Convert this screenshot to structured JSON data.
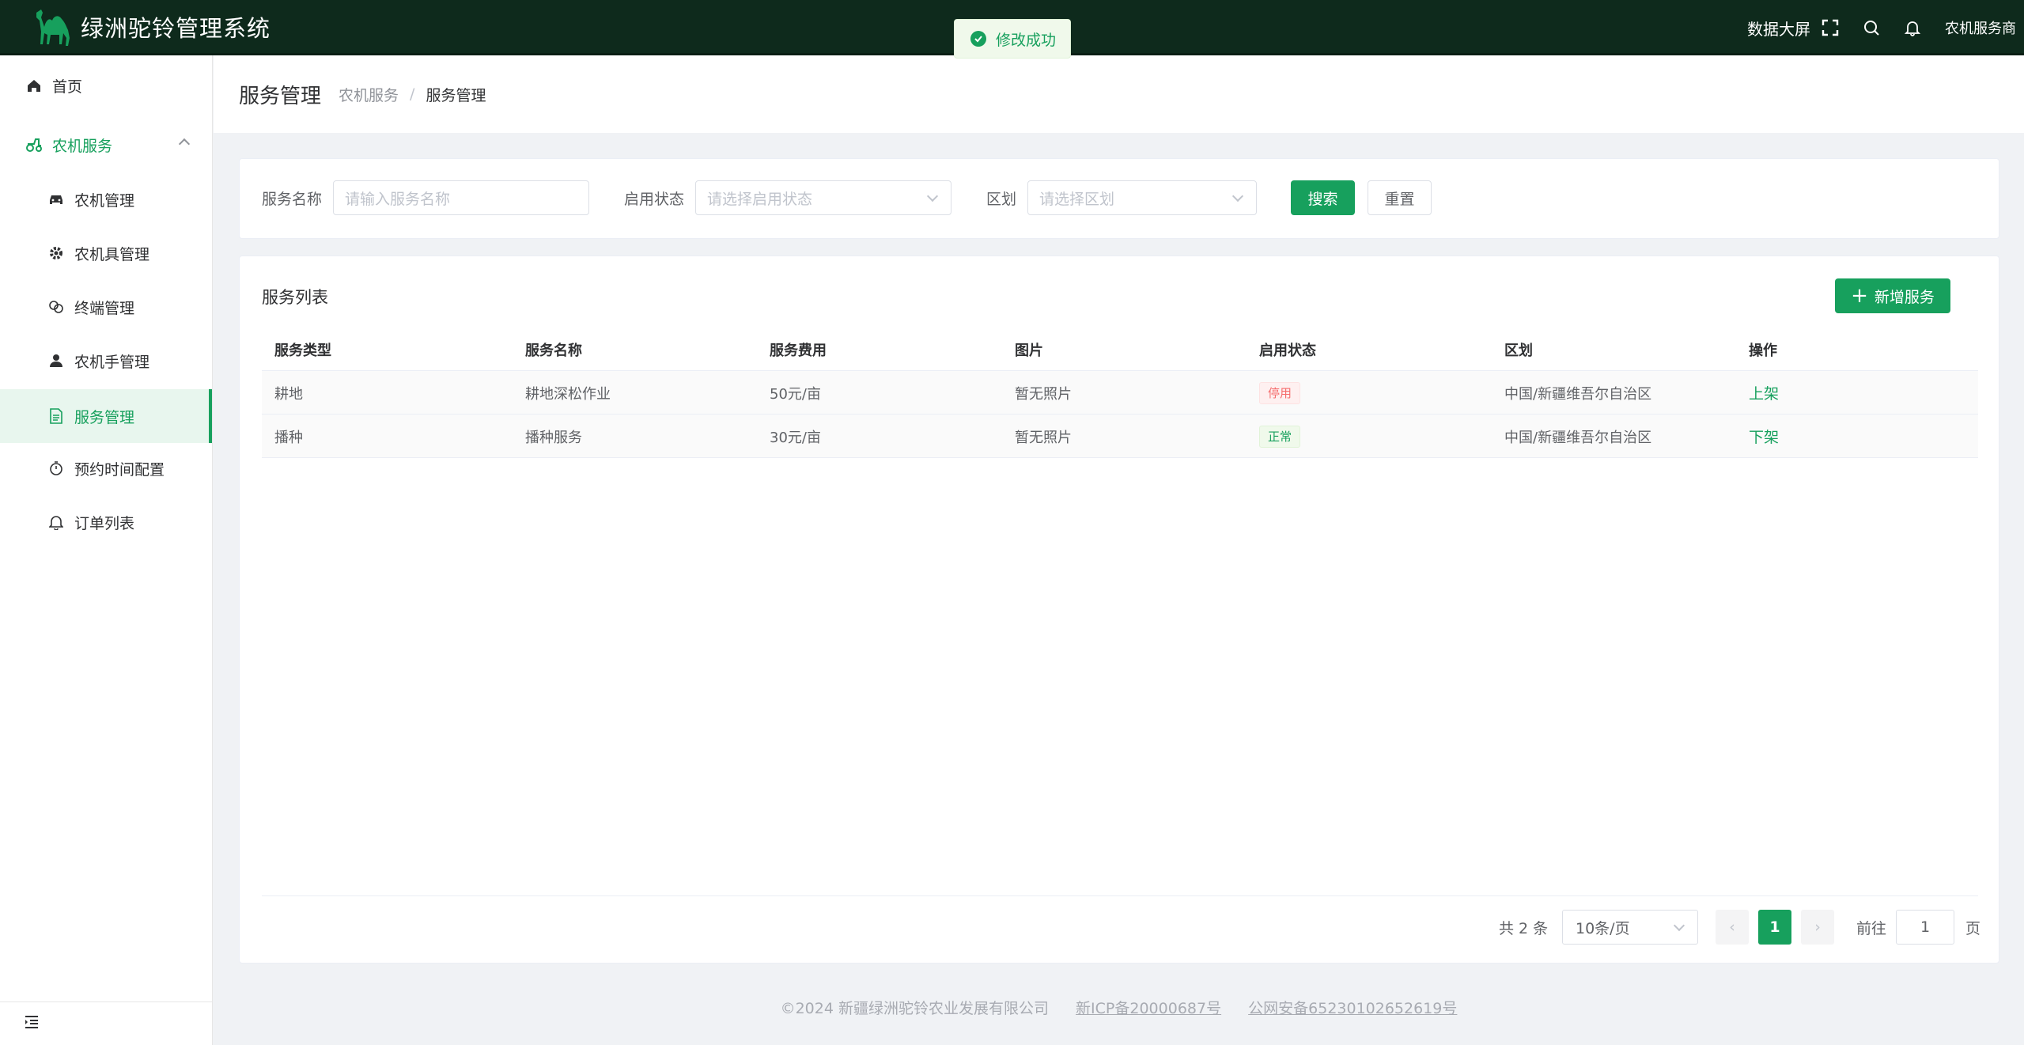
{
  "app": {
    "title": "绿洲驼铃管理系统"
  },
  "header": {
    "big_screen": "数据大屏",
    "user_role": "农机服务商"
  },
  "toast": {
    "message": "修改成功"
  },
  "sidebar": {
    "home": "首页",
    "group": "农机服务",
    "items": [
      "农机管理",
      "农机具管理",
      "终端管理",
      "农机手管理",
      "服务管理",
      "预约时间配置",
      "订单列表"
    ]
  },
  "page": {
    "title": "服务管理",
    "breadcrumb": [
      "农机服务",
      "服务管理"
    ]
  },
  "search": {
    "name_label": "服务名称",
    "name_placeholder": "请输入服务名称",
    "status_label": "启用状态",
    "status_placeholder": "请选择启用状态",
    "region_label": "区划",
    "region_placeholder": "请选择区划",
    "search_btn": "搜索",
    "reset_btn": "重置"
  },
  "list": {
    "title": "服务列表",
    "add_btn": "新增服务",
    "columns": [
      "服务类型",
      "服务名称",
      "服务费用",
      "图片",
      "启用状态",
      "区划",
      "操作"
    ],
    "rows": [
      {
        "type": "耕地",
        "name": "耕地深松作业",
        "fee": "50元/亩",
        "image": "暂无照片",
        "status": "停用",
        "region": "中国/新疆维吾尔自治区",
        "action": "上架"
      },
      {
        "type": "播种",
        "name": "播种服务",
        "fee": "30元/亩",
        "image": "暂无照片",
        "status": "正常",
        "region": "中国/新疆维吾尔自治区",
        "action": "下架"
      }
    ]
  },
  "pagination": {
    "total": "共 2 条",
    "page_size": "10条/页",
    "current": "1",
    "goto_label": "前往",
    "goto_value": "1",
    "page_unit": "页"
  },
  "footer": {
    "copyright": "©2024 新疆绿洲驼铃农业发展有限公司",
    "icp": "新ICP备20000687号",
    "police": "公网安备65230102652619号"
  },
  "colors": {
    "primary": "#17a05d",
    "header_bg": "#0e2a1c",
    "danger": "#f56c6c"
  }
}
